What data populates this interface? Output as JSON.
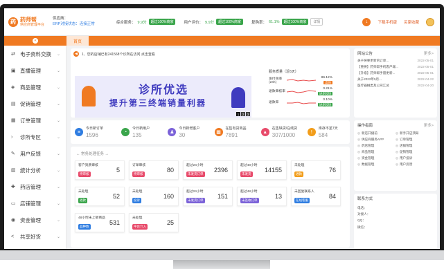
{
  "header": {
    "logo_mark": "药",
    "logo_name": "药师帮",
    "logo_sub": "供应商管理平台",
    "supplier_label": "供应商：",
    "erp_status": "ERP对接状态：连接正常",
    "kpis": [
      {
        "label": "综合服务：",
        "value": "9.9分",
        "badge": "超过100%商家"
      },
      {
        "label": "用户评价：",
        "value": "9.9分",
        "badge": "超过100%商家"
      },
      {
        "label": "复购率：",
        "value": "61.1%",
        "badge": "超过100%商家",
        "extra": "详情"
      }
    ],
    "download_label": "下载手机版",
    "link_label": "买家收藏",
    "download_icon": "download-icon"
  },
  "tabs": {
    "collapse_icon": "collapse-icon",
    "home": "首页"
  },
  "sidebar": {
    "items": [
      {
        "label": "电子资料交换",
        "icon": "exchange-icon",
        "glyph": "⇄"
      },
      {
        "label": "直播管理",
        "icon": "live-icon",
        "glyph": "▣"
      },
      {
        "label": "商品管理",
        "icon": "goods-icon",
        "glyph": "◈"
      },
      {
        "label": "促销管理",
        "icon": "promo-icon",
        "glyph": "▤"
      },
      {
        "label": "订单管理",
        "icon": "order-icon",
        "glyph": "▦"
      },
      {
        "label": "诊所专区",
        "icon": "clinic-icon",
        "glyph": "›"
      },
      {
        "label": "用户反馈",
        "icon": "feedback-icon",
        "glyph": "✎"
      },
      {
        "label": "统计分析",
        "icon": "chart-icon",
        "glyph": "▥"
      },
      {
        "label": "药店管理",
        "icon": "store-icon",
        "glyph": "✚"
      },
      {
        "label": "店铺管理",
        "icon": "shop-icon",
        "glyph": "▭"
      },
      {
        "label": "资金管理",
        "icon": "money-icon",
        "glyph": "◉"
      },
      {
        "label": "共享好货",
        "icon": "share-icon",
        "glyph": "<"
      }
    ]
  },
  "notice": {
    "icon": "megaphone-icon",
    "text": "1、您的店铺已有241568个诊所在访问 点击查看",
    "more": ""
  },
  "banner": {
    "title": "诊所优选",
    "subtitle": "提升第三终端销量利器",
    "pages": [
      "1",
      "2",
      "3"
    ]
  },
  "ranking": {
    "title": "服务质量（近6天）",
    "rows": [
      {
        "label": "发付效率(24h)",
        "pct": "86.12%",
        "tag": "高效",
        "tag_color": "orange"
      },
      {
        "label": "退款审核率",
        "pct": "0.21%",
        "tag": "进步较快",
        "tag_color": "green"
      },
      {
        "label": "退款率",
        "pct": "0.10%",
        "tag": "进步较快",
        "tag_color": "green"
      }
    ]
  },
  "stats": [
    {
      "label": "今日新订单",
      "value": "1596",
      "icon": "order-icon",
      "color": "#2f7de1",
      "glyph": "≡"
    },
    {
      "label": "今日新用户",
      "value": "135",
      "icon": "user-icon",
      "color": "#3aa54b",
      "glyph": "◔"
    },
    {
      "label": "今日新增客户",
      "value": "30",
      "icon": "customer-icon",
      "color": "#7b62d8",
      "glyph": "♟"
    },
    {
      "label": "在售有货商品",
      "value": "7891",
      "icon": "cart-icon",
      "color": "#f07a22",
      "glyph": "▩"
    },
    {
      "label": "在售缺货/在线货",
      "value": "307/1000",
      "icon": "stock-icon",
      "color": "#e84a6a",
      "glyph": "▲"
    },
    {
      "label": "库存不足7天",
      "value": "584",
      "icon": "warning-icon",
      "color": "#f29d1a",
      "glyph": "!"
    }
  ],
  "tasks": {
    "title": "← 常务处理任务 →",
    "items": [
      {
        "name": "客户资质审核",
        "badge": "待审核",
        "badge_color": "#e84a6a",
        "value": "5"
      },
      {
        "name": "订单审核",
        "badge": "待审核",
        "badge_color": "#e84a6a",
        "value": "80"
      },
      {
        "name": "超过24小时",
        "badge": "未发货订单",
        "badge_color": "#e84a6a",
        "value": "2396"
      },
      {
        "name": "超过48小时",
        "badge": "未发货",
        "badge_color": "#e84a6a",
        "value": "14155"
      },
      {
        "name": "未处理",
        "badge": "进款",
        "badge_color": "#f29d1a",
        "value": "76"
      },
      {
        "name": "未处理",
        "badge": "退款",
        "badge_color": "#3aa54b",
        "value": "52"
      },
      {
        "name": "未处理",
        "badge": "投诉",
        "badge_color": "#2f7de1",
        "value": "160"
      },
      {
        "name": "超过24小时",
        "badge": "未发货订单",
        "badge_color": "#7b62d8",
        "value": "151"
      },
      {
        "name": "超过48小时",
        "badge": "未签收订单",
        "badge_color": "#7b62d8",
        "value": "13"
      },
      {
        "name": "未回复联系人",
        "badge": "在线客服",
        "badge_color": "#2f7de1",
        "value": "84"
      },
      {
        "name": "48小时未上架商品",
        "badge": "品种数",
        "badge_color": "#2f7de1",
        "value": "531"
      },
      {
        "name": "未处理",
        "badge": "平台介入",
        "badge_color": "#e84a6a",
        "value": "25"
      }
    ]
  },
  "right": {
    "announcements": {
      "title": "网站公告",
      "more": "更多>",
      "items": [
        {
          "text": "关于将要更新的订单...",
          "date": "2022-05-01"
        },
        {
          "text": "【重要】药师帮手机客户端...",
          "date": "2022-05-01"
        },
        {
          "text": "【升级】药师帮手册更新...",
          "date": "2022-05-01"
        },
        {
          "text": "关于2022年5月...",
          "date": "2022-04-22"
        },
        {
          "text": "医疗器械类及公司汇总",
          "date": "2022-04-20"
        }
      ]
    },
    "ops": {
      "title": "操作指南",
      "more": "更多>",
      "items": [
        "新店开播前",
        "新手开店须知",
        "供应商服务APP",
        "订单管理",
        "药店管理",
        "店铺管理",
        "商品管理",
        "促销管理",
        "资金管理",
        "用户投诉",
        "数据管理",
        "用户反馈"
      ]
    },
    "contact": {
      "title": "联系方式",
      "lines": [
        "电话：",
        "对接人：",
        "QQ：",
        "微信："
      ]
    }
  }
}
